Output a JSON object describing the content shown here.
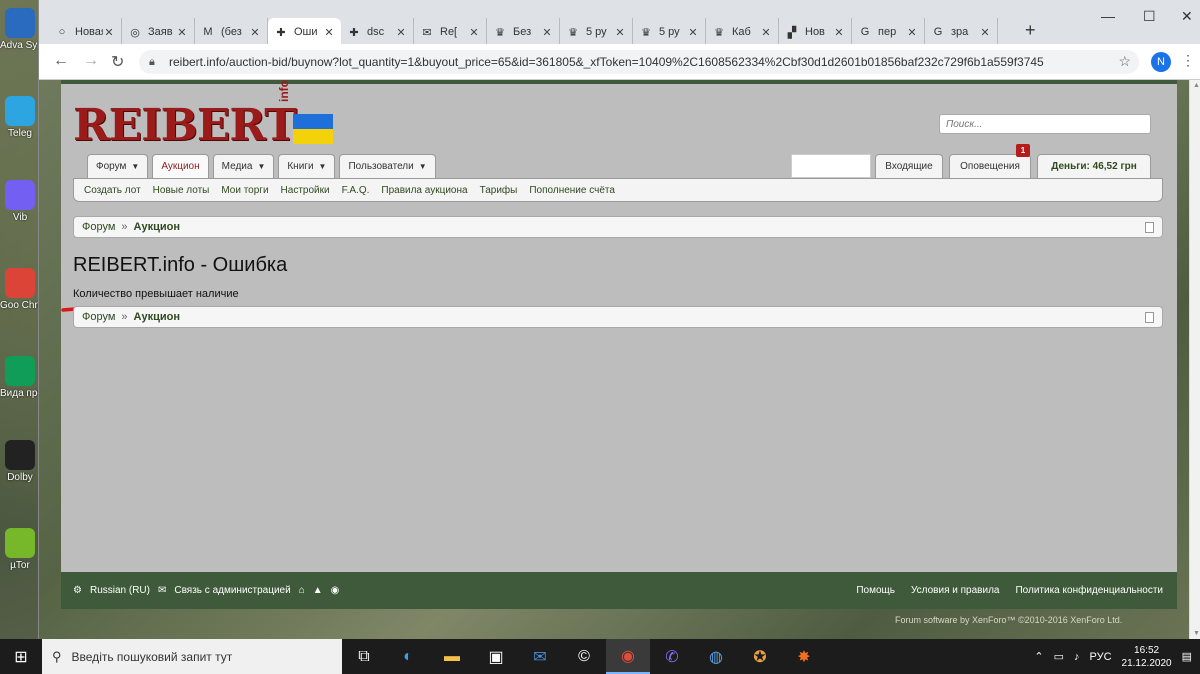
{
  "desktop": {
    "icons": [
      {
        "label": "Adva Syster",
        "color": "#2a6bbf"
      },
      {
        "label": "Teleg",
        "color": "#2ca5e0"
      },
      {
        "label": "Vib",
        "color": "#7360f2"
      },
      {
        "label": "Goo Chro",
        "color": "#db4437"
      },
      {
        "label": "Вида прогр",
        "color": "#0f9d58"
      },
      {
        "label": "Dolby",
        "color": "#222222"
      },
      {
        "label": "µTor",
        "color": "#77b82a"
      }
    ]
  },
  "browser": {
    "tabs": [
      {
        "title": "Новая в",
        "icon": "globe-icon",
        "glyph": "○"
      },
      {
        "title": "Заяв",
        "icon": "globe-icon",
        "glyph": "◎"
      },
      {
        "title": "(без",
        "icon": "gmail-icon",
        "glyph": "M"
      },
      {
        "title": "Оши",
        "icon": "cross-icon",
        "glyph": "✚"
      },
      {
        "title": "dsc",
        "icon": "cross-icon",
        "glyph": "✚"
      },
      {
        "title": "Re[",
        "icon": "mail-icon",
        "glyph": "✉"
      },
      {
        "title": "Без",
        "icon": "crown-icon",
        "glyph": "♛"
      },
      {
        "title": "5 ру",
        "icon": "crown-icon",
        "glyph": "♛"
      },
      {
        "title": "5 ру",
        "icon": "crown-icon",
        "glyph": "♛"
      },
      {
        "title": "Каб",
        "icon": "crown-icon",
        "glyph": "♛"
      },
      {
        "title": "Нов",
        "icon": "site-icon",
        "glyph": "▞"
      },
      {
        "title": "пер",
        "icon": "google-icon",
        "glyph": "G"
      },
      {
        "title": "зра",
        "icon": "google-icon",
        "glyph": "G"
      }
    ],
    "active_tab": 3,
    "url": "reibert.info/auction-bid/buynow?lot_quantity=1&buyout_price=65&id=361805&_xfToken=10409%2C1608562334%2Cbf30d1d2601b01856baf232c729f6b1a559f3745",
    "profile_letter": "N"
  },
  "page": {
    "logo_text": "REIBERT",
    "logo_sup": "info",
    "search_placeholder": "Поиск...",
    "nav_tabs": [
      {
        "label": "Форум",
        "dropdown": true
      },
      {
        "label": "Аукцион",
        "dropdown": false,
        "selected": true
      },
      {
        "label": "Медиа",
        "dropdown": true
      },
      {
        "label": "Книги",
        "dropdown": true
      },
      {
        "label": "Пользователи",
        "dropdown": true
      }
    ],
    "inbox_label": "Входящие",
    "alerts_label": "Оповещения",
    "alerts_count": "1",
    "money_label": "Деньги: 46,52 грн",
    "subnav": [
      "Создать лот",
      "Новые лоты",
      "Мои торги",
      "Настройки",
      "F.A.Q.",
      "Правила аукциона",
      "Тарифы",
      "Пополнение счёта"
    ],
    "breadcrumb": {
      "root": "Форум",
      "separator": "»",
      "current": "Аукцион"
    },
    "title": "REIBERT.info - Ошибка",
    "error_message": "Количество превышает наличие",
    "footer": {
      "language": "Russian (RU)",
      "contact": "Связь с администрацией",
      "links": [
        "Помощь",
        "Условия и правила",
        "Политика конфиденциальности"
      ],
      "copyright": "Forum software by XenForo™ ©2010-2016 XenForo Ltd."
    }
  },
  "taskbar": {
    "search_placeholder": "Введіть пошуковий запит тут",
    "lang": "РУС",
    "time": "16:52",
    "date": "21.12.2020"
  },
  "colors": {
    "brand_red": "#9b1a1a",
    "forum_green": "#3f5a3a",
    "annotation_red": "#e01414"
  }
}
